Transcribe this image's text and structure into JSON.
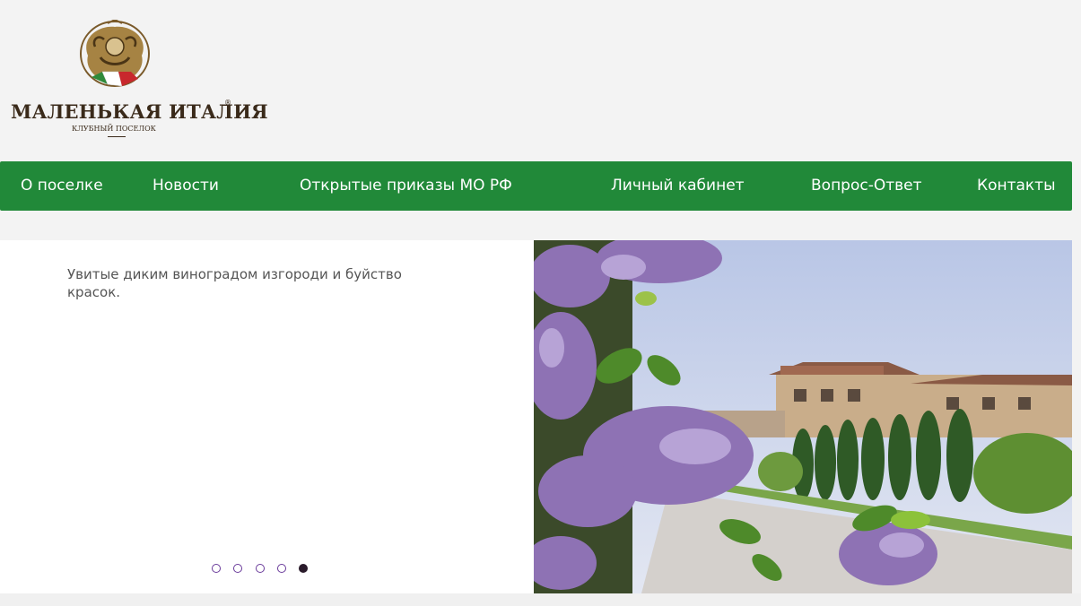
{
  "logo": {
    "name": "МАЛЕНЬКАЯ ИТАЛИЯ",
    "reg": "®",
    "subtitle": "КЛУБНЫЙ ПОСЕЛОК"
  },
  "nav": {
    "items": [
      {
        "label": "О поселке"
      },
      {
        "label": "Новости"
      },
      {
        "label": "Открытые приказы МО РФ"
      },
      {
        "label": "Личный кабинет"
      },
      {
        "label": "Вопрос-Ответ"
      },
      {
        "label": "Контакты"
      }
    ]
  },
  "slider": {
    "caption": "Увитые диким виноградом изгороди и буйство красок.",
    "active_index": 4
  },
  "colors": {
    "nav_bg": "#218939",
    "logo_text": "#3a2a1a",
    "dot_border": "#6a3b9a"
  }
}
